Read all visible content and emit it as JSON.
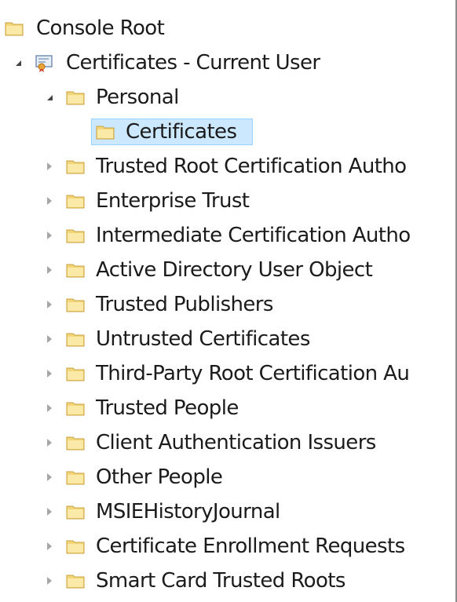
{
  "tree": {
    "items": [
      {
        "label": "Console Root",
        "icon": "folder-icon",
        "expander": "none"
      },
      {
        "label": "Certificates - Current User",
        "icon": "certificate-snapin-icon",
        "expander": "expanded"
      },
      {
        "label": "Personal",
        "icon": "folder-icon",
        "expander": "expanded"
      },
      {
        "label": "Certificates",
        "icon": "folder-icon",
        "expander": "none",
        "selected": true
      },
      {
        "label": "Trusted Root Certification Autho",
        "icon": "folder-icon",
        "expander": "collapsed"
      },
      {
        "label": "Enterprise Trust",
        "icon": "folder-icon",
        "expander": "collapsed"
      },
      {
        "label": "Intermediate Certification Autho",
        "icon": "folder-icon",
        "expander": "collapsed"
      },
      {
        "label": "Active Directory User Object",
        "icon": "folder-icon",
        "expander": "collapsed"
      },
      {
        "label": "Trusted Publishers",
        "icon": "folder-icon",
        "expander": "collapsed"
      },
      {
        "label": "Untrusted Certificates",
        "icon": "folder-icon",
        "expander": "collapsed"
      },
      {
        "label": "Third-Party Root Certification Au",
        "icon": "folder-icon",
        "expander": "collapsed"
      },
      {
        "label": "Trusted People",
        "icon": "folder-icon",
        "expander": "collapsed"
      },
      {
        "label": "Client Authentication Issuers",
        "icon": "folder-icon",
        "expander": "collapsed"
      },
      {
        "label": "Other People",
        "icon": "folder-icon",
        "expander": "collapsed"
      },
      {
        "label": "MSIEHistoryJournal",
        "icon": "folder-icon",
        "expander": "collapsed"
      },
      {
        "label": "Certificate Enrollment Requests",
        "icon": "folder-icon",
        "expander": "collapsed"
      },
      {
        "label": "Smart Card Trusted Roots",
        "icon": "folder-icon",
        "expander": "collapsed"
      }
    ]
  },
  "colors": {
    "selection_fill": "#cce8ff",
    "selection_border": "#99d1ff",
    "folder_fill": "#f3d67a",
    "folder_edge": "#c8a23c"
  }
}
